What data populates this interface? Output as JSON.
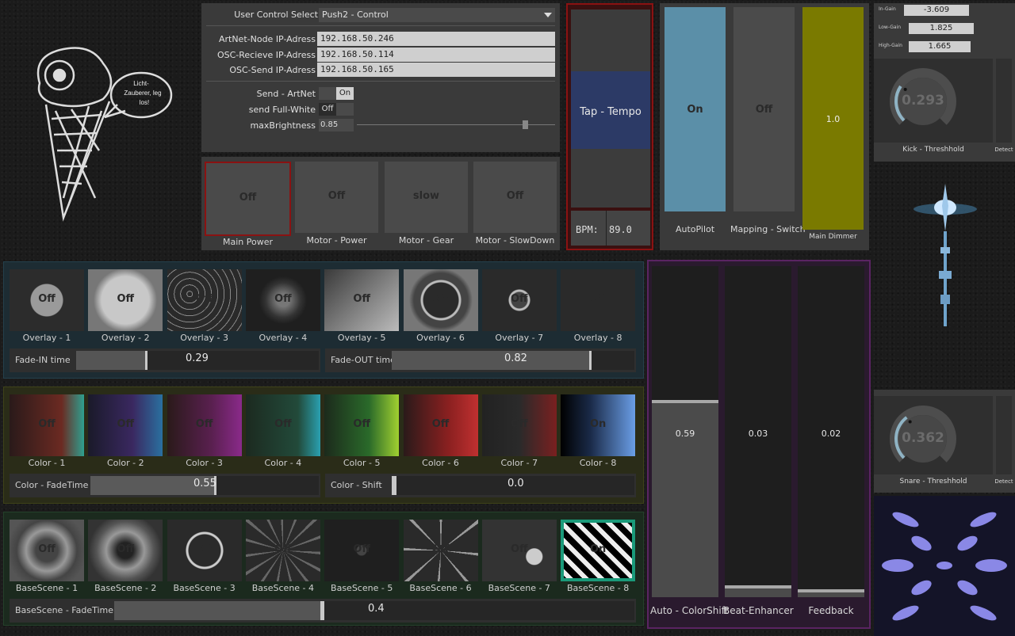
{
  "settings": {
    "user_control_label": "User Control Select",
    "user_control_value": "Push2 - Control",
    "artnet_label": "ArtNet-Node IP-Adress",
    "artnet_value": "192.168.50.246",
    "osc_receive_label": "OSC-Recieve IP-Adress",
    "osc_receive_value": "192.168.50.114",
    "osc_send_label": "OSC-Send IP-Adress",
    "osc_send_value": "192.168.50.165",
    "send_artnet_label": "Send - ArtNet",
    "send_artnet_value": "On",
    "send_full_white_label": "send Full-White",
    "send_full_white_value": "Off",
    "max_brightness_label": "maxBrightness",
    "max_brightness_value": "0.85",
    "max_brightness_level": 0.85
  },
  "power": [
    {
      "state": "Off",
      "label": "Main Power"
    },
    {
      "state": "Off",
      "label": "Motor - Power"
    },
    {
      "state": "slow",
      "label": "Motor - Gear"
    },
    {
      "state": "Off",
      "label": "Motor - SlowDown"
    }
  ],
  "tempo": {
    "tap_label": "Tap - Tempo",
    "bpm_label": "BPM:",
    "bpm_value": "89.0"
  },
  "right_toggles": [
    {
      "state": "On",
      "label": "AutoPilot",
      "color": "#5b8fa8"
    },
    {
      "state": "Off",
      "label": "Mapping - Switch",
      "color": "#4b4b4b"
    },
    {
      "state": "1.0",
      "label": "Main Dimmer",
      "color": "#7a7a00"
    }
  ],
  "gains": [
    {
      "label": "In-Gain",
      "value": "-3.609"
    },
    {
      "label": "Low-Gain",
      "value": "1.825"
    },
    {
      "label": "High-Gain",
      "value": "1.665"
    }
  ],
  "kick": {
    "value": "0.293",
    "label": "Kick - Threshhold",
    "detect": "Detect",
    "level": 0.293
  },
  "snare": {
    "value": "0.362",
    "label": "Snare - Threshhold",
    "detect": "Detect",
    "level": 0.362
  },
  "logo": {
    "speech": "Licht-Zauberer, leg los!"
  },
  "overlays": [
    {
      "state": "Off",
      "label": "Overlay - 1"
    },
    {
      "state": "Off",
      "label": "Overlay - 2"
    },
    {
      "state": "Off",
      "label": "Overlay - 3"
    },
    {
      "state": "Off",
      "label": "Overlay - 4"
    },
    {
      "state": "Off",
      "label": "Overlay - 5"
    },
    {
      "state": "Off",
      "label": "Overlay - 6"
    },
    {
      "state": "Off",
      "label": "Overlay - 7"
    },
    {
      "state": "Off",
      "label": "Overlay - 8"
    }
  ],
  "fade_in": {
    "label": "Fade-IN time",
    "value": "0.29",
    "level": 0.29
  },
  "fade_out": {
    "label": "Fade-OUT time",
    "value": "0.82",
    "level": 0.82
  },
  "colors": [
    {
      "state": "Off",
      "label": "Color - 1"
    },
    {
      "state": "Off",
      "label": "Color - 2"
    },
    {
      "state": "Off",
      "label": "Color - 3"
    },
    {
      "state": "Off",
      "label": "Color - 4"
    },
    {
      "state": "Off",
      "label": "Color - 5"
    },
    {
      "state": "Off",
      "label": "Color - 6"
    },
    {
      "state": "Off",
      "label": "Color - 7"
    },
    {
      "state": "On",
      "label": "Color - 8"
    }
  ],
  "color_fade": {
    "label": "Color - FadeTime",
    "value": "0.55",
    "level": 0.55
  },
  "color_shift": {
    "label": "Color - Shift",
    "value": "0.0",
    "level": 0.0
  },
  "basescenes": [
    {
      "state": "Off",
      "label": "BaseScene - 1"
    },
    {
      "state": "Off",
      "label": "BaseScene - 2"
    },
    {
      "state": "Off",
      "label": "BaseScene - 3"
    },
    {
      "state": "Off",
      "label": "BaseScene - 4"
    },
    {
      "state": "Off",
      "label": "BaseScene - 5"
    },
    {
      "state": "Off",
      "label": "BaseScene - 6"
    },
    {
      "state": "Off",
      "label": "BaseScene - 7"
    },
    {
      "state": "On",
      "label": "BaseScene - 8"
    }
  ],
  "base_fade": {
    "label": "BaseScene - FadeTime",
    "value": "0.4",
    "level": 0.4
  },
  "faders": [
    {
      "label": "Auto - ColorShift",
      "value": "0.59",
      "level": 0.59
    },
    {
      "label": "Beat-Enhancer",
      "value": "0.03",
      "level": 0.03
    },
    {
      "label": "Feedback",
      "value": "0.02",
      "level": 0.02
    }
  ]
}
